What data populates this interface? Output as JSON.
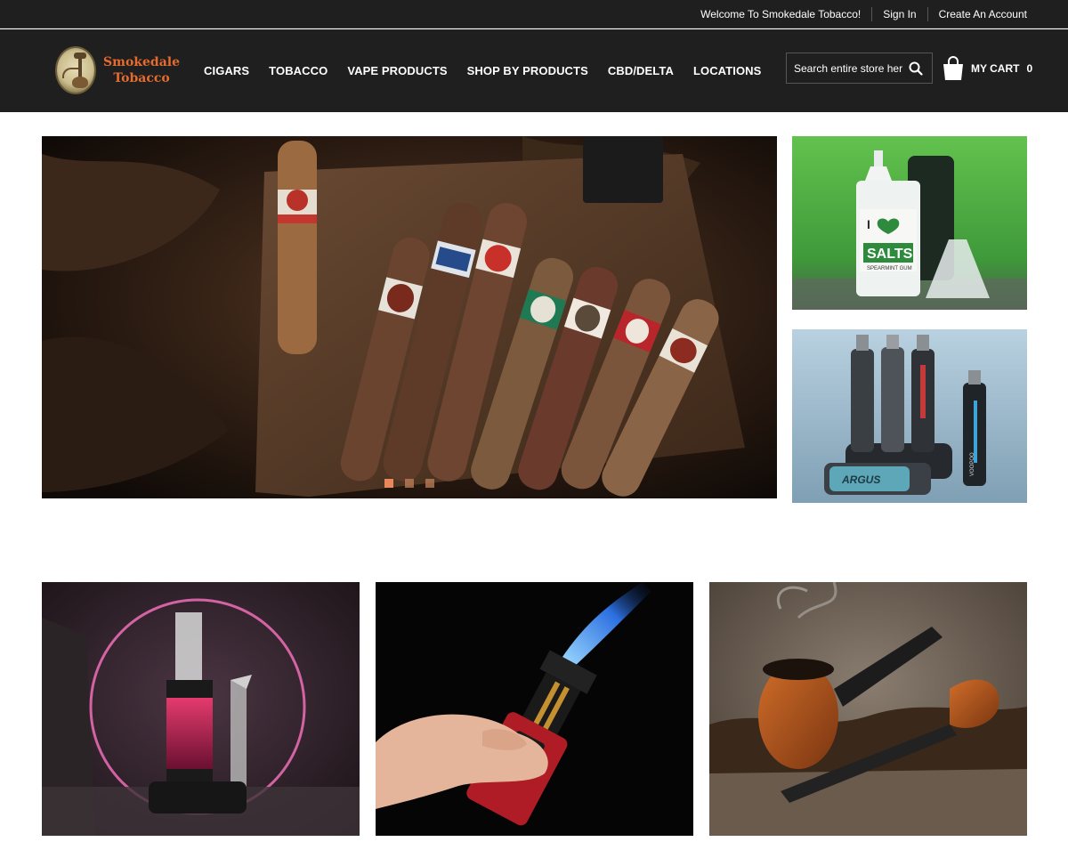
{
  "topbar": {
    "welcome": "Welcome To Smokedale Tobacco!",
    "sign_in": "Sign In",
    "create_account": "Create An Account"
  },
  "logo": {
    "line1": "Smokedale",
    "line2": "Tobacco",
    "icon": "hookah-emblem-icon"
  },
  "nav": {
    "items": [
      "CIGARS",
      "TOBACCO",
      "VAPE PRODUCTS",
      "SHOP BY PRODUCTS",
      "CBD/DELTA",
      "LOCATIONS"
    ]
  },
  "search": {
    "placeholder": "Search entire store here...",
    "icon": "search-icon"
  },
  "cart": {
    "label": "MY CART",
    "count": "0",
    "icon": "shopping-bag-icon"
  },
  "slider": {
    "slides": 3,
    "active": 1
  },
  "banners": {
    "side": [
      {
        "label_lines": [
          "I",
          "SALTS"
        ],
        "caption": "SPEARMINT GUM"
      },
      {
        "label": "ARGUS",
        "brand": "VOOPOO"
      }
    ]
  },
  "colors": {
    "header_bg": "#1f1f1f",
    "logo_accent": "#e56b2e",
    "slider_dot": "#e8875a"
  }
}
